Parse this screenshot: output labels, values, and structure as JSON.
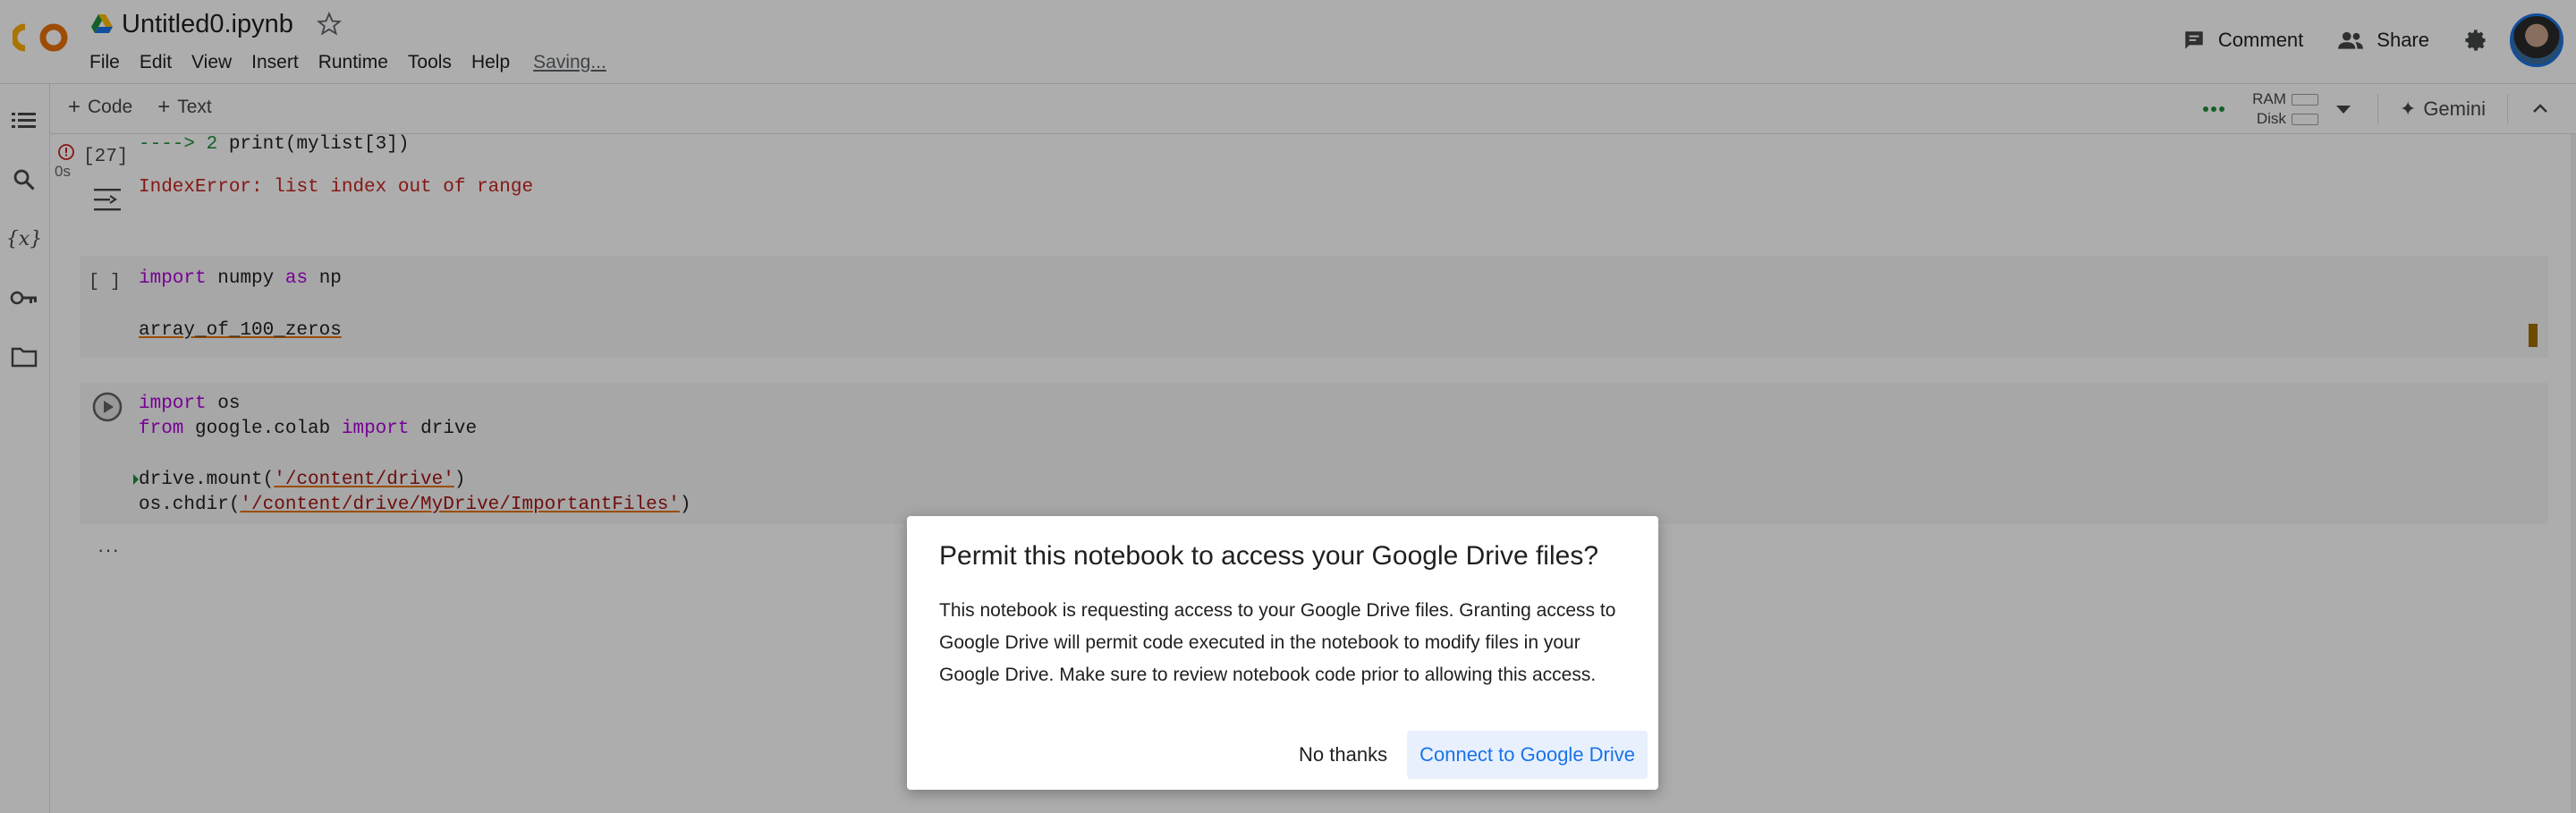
{
  "header": {
    "logo_text": "CO",
    "notebook_title": "Untitled0.ipynb",
    "menu": [
      "File",
      "Edit",
      "View",
      "Insert",
      "Runtime",
      "Tools",
      "Help"
    ],
    "saving_status": "Saving...",
    "comment_label": "Comment",
    "share_label": "Share"
  },
  "toolbar": {
    "code_label": "Code",
    "text_label": "Text",
    "ram_label": "RAM",
    "disk_label": "Disk",
    "gemini_label": "Gemini"
  },
  "rail": {
    "icons": [
      "toc-icon",
      "search-icon",
      "variables-icon",
      "key-icon",
      "folder-icon"
    ]
  },
  "output": {
    "exec_count": "[27]",
    "exec_time": "0s",
    "traceback_arrow": "----> 2",
    "traceback_code": "print(mylist[3])",
    "error_name": "IndexError",
    "error_message": ": list index out of range"
  },
  "cell1": {
    "run_label": "[ ]",
    "line1_kw1": "import",
    "line1_mod": "numpy",
    "line1_kw2": "as",
    "line1_alias": "np",
    "line2": "array_of_100_zeros"
  },
  "cell2": {
    "l1_kw": "import",
    "l1_mod": "os",
    "l2_kw1": "from",
    "l2_mod": "google.colab",
    "l2_kw2": "import",
    "l2_name": "drive",
    "l3_call": "drive.mount(",
    "l3_str": "'/content/drive'",
    "l3_close": ")",
    "l4_call": "os.chdir(",
    "l4_str": "'/content/drive/MyDrive/ImportantFiles'",
    "l4_close": ")",
    "more": "···"
  },
  "dialog": {
    "title": "Permit this notebook to access your Google Drive files?",
    "body": "This notebook is requesting access to your Google Drive files. Granting access to Google Drive will permit code executed in the notebook to modify files in your Google Drive. Make sure to review notebook code prior to allowing this access.",
    "cancel_label": "No thanks",
    "confirm_label": "Connect to Google Drive"
  },
  "colors": {
    "accent": "#1a73e8",
    "logo_orange": "#f9ab00",
    "error_red": "#c5221f",
    "keyword_purple": "#af00db",
    "string_red": "#a31515"
  }
}
